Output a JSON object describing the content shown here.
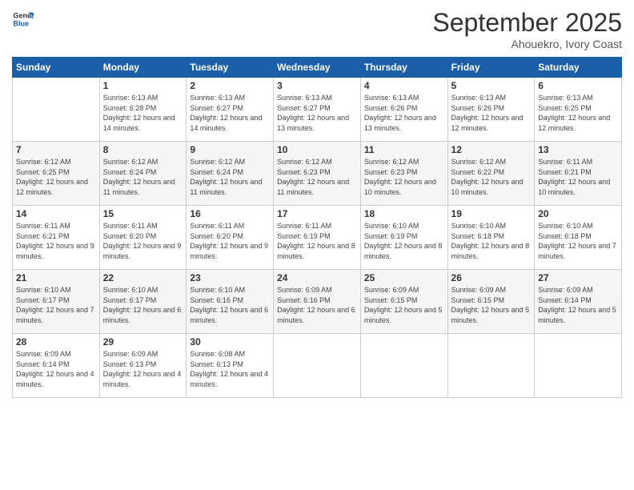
{
  "logo": {
    "line1": "General",
    "line2": "Blue"
  },
  "title": "September 2025",
  "location": "Ahouekro, Ivory Coast",
  "days_of_week": [
    "Sunday",
    "Monday",
    "Tuesday",
    "Wednesday",
    "Thursday",
    "Friday",
    "Saturday"
  ],
  "weeks": [
    [
      {
        "day": "",
        "sunrise": "",
        "sunset": "",
        "daylight": ""
      },
      {
        "day": "1",
        "sunrise": "Sunrise: 6:13 AM",
        "sunset": "Sunset: 6:28 PM",
        "daylight": "Daylight: 12 hours and 14 minutes."
      },
      {
        "day": "2",
        "sunrise": "Sunrise: 6:13 AM",
        "sunset": "Sunset: 6:27 PM",
        "daylight": "Daylight: 12 hours and 14 minutes."
      },
      {
        "day": "3",
        "sunrise": "Sunrise: 6:13 AM",
        "sunset": "Sunset: 6:27 PM",
        "daylight": "Daylight: 12 hours and 13 minutes."
      },
      {
        "day": "4",
        "sunrise": "Sunrise: 6:13 AM",
        "sunset": "Sunset: 6:26 PM",
        "daylight": "Daylight: 12 hours and 13 minutes."
      },
      {
        "day": "5",
        "sunrise": "Sunrise: 6:13 AM",
        "sunset": "Sunset: 6:26 PM",
        "daylight": "Daylight: 12 hours and 12 minutes."
      },
      {
        "day": "6",
        "sunrise": "Sunrise: 6:13 AM",
        "sunset": "Sunset: 6:25 PM",
        "daylight": "Daylight: 12 hours and 12 minutes."
      }
    ],
    [
      {
        "day": "7",
        "sunrise": "Sunrise: 6:12 AM",
        "sunset": "Sunset: 6:25 PM",
        "daylight": "Daylight: 12 hours and 12 minutes."
      },
      {
        "day": "8",
        "sunrise": "Sunrise: 6:12 AM",
        "sunset": "Sunset: 6:24 PM",
        "daylight": "Daylight: 12 hours and 11 minutes."
      },
      {
        "day": "9",
        "sunrise": "Sunrise: 6:12 AM",
        "sunset": "Sunset: 6:24 PM",
        "daylight": "Daylight: 12 hours and 11 minutes."
      },
      {
        "day": "10",
        "sunrise": "Sunrise: 6:12 AM",
        "sunset": "Sunset: 6:23 PM",
        "daylight": "Daylight: 12 hours and 11 minutes."
      },
      {
        "day": "11",
        "sunrise": "Sunrise: 6:12 AM",
        "sunset": "Sunset: 6:23 PM",
        "daylight": "Daylight: 12 hours and 10 minutes."
      },
      {
        "day": "12",
        "sunrise": "Sunrise: 6:12 AM",
        "sunset": "Sunset: 6:22 PM",
        "daylight": "Daylight: 12 hours and 10 minutes."
      },
      {
        "day": "13",
        "sunrise": "Sunrise: 6:11 AM",
        "sunset": "Sunset: 6:21 PM",
        "daylight": "Daylight: 12 hours and 10 minutes."
      }
    ],
    [
      {
        "day": "14",
        "sunrise": "Sunrise: 6:11 AM",
        "sunset": "Sunset: 6:21 PM",
        "daylight": "Daylight: 12 hours and 9 minutes."
      },
      {
        "day": "15",
        "sunrise": "Sunrise: 6:11 AM",
        "sunset": "Sunset: 6:20 PM",
        "daylight": "Daylight: 12 hours and 9 minutes."
      },
      {
        "day": "16",
        "sunrise": "Sunrise: 6:11 AM",
        "sunset": "Sunset: 6:20 PM",
        "daylight": "Daylight: 12 hours and 9 minutes."
      },
      {
        "day": "17",
        "sunrise": "Sunrise: 6:11 AM",
        "sunset": "Sunset: 6:19 PM",
        "daylight": "Daylight: 12 hours and 8 minutes."
      },
      {
        "day": "18",
        "sunrise": "Sunrise: 6:10 AM",
        "sunset": "Sunset: 6:19 PM",
        "daylight": "Daylight: 12 hours and 8 minutes."
      },
      {
        "day": "19",
        "sunrise": "Sunrise: 6:10 AM",
        "sunset": "Sunset: 6:18 PM",
        "daylight": "Daylight: 12 hours and 8 minutes."
      },
      {
        "day": "20",
        "sunrise": "Sunrise: 6:10 AM",
        "sunset": "Sunset: 6:18 PM",
        "daylight": "Daylight: 12 hours and 7 minutes."
      }
    ],
    [
      {
        "day": "21",
        "sunrise": "Sunrise: 6:10 AM",
        "sunset": "Sunset: 6:17 PM",
        "daylight": "Daylight: 12 hours and 7 minutes."
      },
      {
        "day": "22",
        "sunrise": "Sunrise: 6:10 AM",
        "sunset": "Sunset: 6:17 PM",
        "daylight": "Daylight: 12 hours and 6 minutes."
      },
      {
        "day": "23",
        "sunrise": "Sunrise: 6:10 AM",
        "sunset": "Sunset: 6:16 PM",
        "daylight": "Daylight: 12 hours and 6 minutes."
      },
      {
        "day": "24",
        "sunrise": "Sunrise: 6:09 AM",
        "sunset": "Sunset: 6:16 PM",
        "daylight": "Daylight: 12 hours and 6 minutes."
      },
      {
        "day": "25",
        "sunrise": "Sunrise: 6:09 AM",
        "sunset": "Sunset: 6:15 PM",
        "daylight": "Daylight: 12 hours and 5 minutes."
      },
      {
        "day": "26",
        "sunrise": "Sunrise: 6:09 AM",
        "sunset": "Sunset: 6:15 PM",
        "daylight": "Daylight: 12 hours and 5 minutes."
      },
      {
        "day": "27",
        "sunrise": "Sunrise: 6:09 AM",
        "sunset": "Sunset: 6:14 PM",
        "daylight": "Daylight: 12 hours and 5 minutes."
      }
    ],
    [
      {
        "day": "28",
        "sunrise": "Sunrise: 6:09 AM",
        "sunset": "Sunset: 6:14 PM",
        "daylight": "Daylight: 12 hours and 4 minutes."
      },
      {
        "day": "29",
        "sunrise": "Sunrise: 6:09 AM",
        "sunset": "Sunset: 6:13 PM",
        "daylight": "Daylight: 12 hours and 4 minutes."
      },
      {
        "day": "30",
        "sunrise": "Sunrise: 6:08 AM",
        "sunset": "Sunset: 6:13 PM",
        "daylight": "Daylight: 12 hours and 4 minutes."
      },
      {
        "day": "",
        "sunrise": "",
        "sunset": "",
        "daylight": ""
      },
      {
        "day": "",
        "sunrise": "",
        "sunset": "",
        "daylight": ""
      },
      {
        "day": "",
        "sunrise": "",
        "sunset": "",
        "daylight": ""
      },
      {
        "day": "",
        "sunrise": "",
        "sunset": "",
        "daylight": ""
      }
    ]
  ]
}
